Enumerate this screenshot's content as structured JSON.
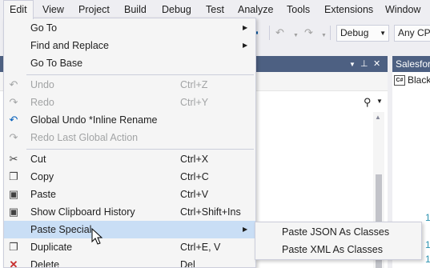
{
  "menubar": {
    "items": [
      "Edit",
      "View",
      "Project",
      "Build",
      "Debug",
      "Test",
      "Analyze",
      "Tools",
      "Extensions",
      "Window"
    ]
  },
  "toolbar": {
    "config_value": "Debug",
    "platform_value": "Any CPU",
    "icons": [
      "save-icon",
      "undo-icon",
      "redo-icon"
    ]
  },
  "right_panel": {
    "title": "Salesforce",
    "item_badge": "C#",
    "item_label": "Black",
    "line_numbers": [
      "1",
      "1",
      "1"
    ]
  },
  "edit_menu": {
    "items": [
      {
        "label": "Go To",
        "shortcut": "",
        "submenu": true,
        "icon": "",
        "disabled": false
      },
      {
        "label": "Find and Replace",
        "shortcut": "",
        "submenu": true,
        "icon": "",
        "disabled": false
      },
      {
        "label": "Go To Base",
        "shortcut": "",
        "submenu": false,
        "icon": "",
        "disabled": false
      },
      {
        "label": "Undo",
        "shortcut": "Ctrl+Z",
        "submenu": false,
        "icon": "undo-icon",
        "disabled": true
      },
      {
        "label": "Redo",
        "shortcut": "Ctrl+Y",
        "submenu": false,
        "icon": "redo-icon",
        "disabled": true
      },
      {
        "label": "Global Undo *Inline Rename",
        "shortcut": "",
        "submenu": false,
        "icon": "global-undo-icon",
        "disabled": false
      },
      {
        "label": "Redo Last Global Action",
        "shortcut": "",
        "submenu": false,
        "icon": "global-redo-icon",
        "disabled": true
      },
      {
        "label": "Cut",
        "shortcut": "Ctrl+X",
        "submenu": false,
        "icon": "scissors-icon",
        "disabled": false
      },
      {
        "label": "Copy",
        "shortcut": "Ctrl+C",
        "submenu": false,
        "icon": "copy-icon",
        "disabled": false
      },
      {
        "label": "Paste",
        "shortcut": "Ctrl+V",
        "submenu": false,
        "icon": "paste-icon",
        "disabled": false
      },
      {
        "label": "Show Clipboard History",
        "shortcut": "Ctrl+Shift+Ins",
        "submenu": false,
        "icon": "clipboard-history-icon",
        "disabled": false
      },
      {
        "label": "Paste Special",
        "shortcut": "",
        "submenu": true,
        "icon": "",
        "disabled": false,
        "highlighted": true
      },
      {
        "label": "Duplicate",
        "shortcut": "Ctrl+E, V",
        "submenu": false,
        "icon": "duplicate-icon",
        "disabled": false
      },
      {
        "label": "Delete",
        "shortcut": "Del",
        "submenu": false,
        "icon": "delete-icon",
        "disabled": false
      }
    ]
  },
  "paste_special_submenu": {
    "items": [
      "Paste JSON As Classes",
      "Paste XML As Classes"
    ]
  },
  "colors": {
    "accent_header": "#4d6082",
    "highlight": "#c9def5",
    "disabled_text": "#a2a4a5",
    "delete_icon": "#c72e2e",
    "global_undo_icon": "#005dba"
  }
}
